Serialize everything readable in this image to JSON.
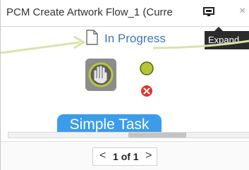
{
  "window": {
    "title": "PCM Create Artwork Flow_1 (Curre",
    "expand_icon": "expand-icon",
    "close_icon": "close-icon",
    "close_glyph": "×"
  },
  "tooltip": {
    "text": "Expand"
  },
  "flow": {
    "status": {
      "icon": "document-icon",
      "label": "In Progress"
    },
    "task": {
      "icon": "hand-stop-icon",
      "label": "Simple Task"
    },
    "connectors": {
      "success": "green-handle",
      "error": "red-x-handle"
    },
    "colors": {
      "link": "#3f76b5",
      "task_label_bg": "#3b9cea",
      "success": "#b4c635",
      "error": "#e0342b",
      "connector_line": "#d9e3a9"
    }
  },
  "pager": {
    "prev_glyph": "<",
    "next_glyph": ">",
    "page": "1",
    "of_text": "of",
    "total": "1"
  }
}
